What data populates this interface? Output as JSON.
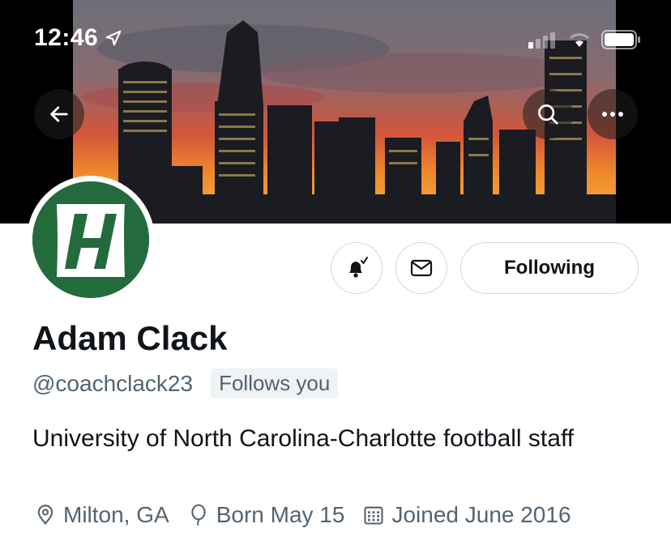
{
  "status_bar": {
    "time": "12:46"
  },
  "header": {
    "banner_image": "charlotte-skyline-sunset",
    "back_icon": "arrow-left-icon",
    "search_icon": "search-icon",
    "more_icon": "more-horizontal-icon"
  },
  "profile": {
    "avatar": "charlotte-49ers-logo",
    "display_name": "Adam Clack",
    "handle": "@coachclack23",
    "follows_you_label": "Follows you",
    "bio": "University of North Carolina-Charlotte football staff",
    "location": "Milton, GA",
    "birthday": "Born May 15",
    "joined": "Joined June 2016"
  },
  "actions": {
    "notifications_icon": "bell-check-icon",
    "message_icon": "envelope-icon",
    "following_label": "Following"
  },
  "colors": {
    "text_primary": "#0f1419",
    "text_secondary": "#536471",
    "border": "#cfd9de",
    "badge_bg": "#eff3f4",
    "logo_green": "#236b3c"
  }
}
